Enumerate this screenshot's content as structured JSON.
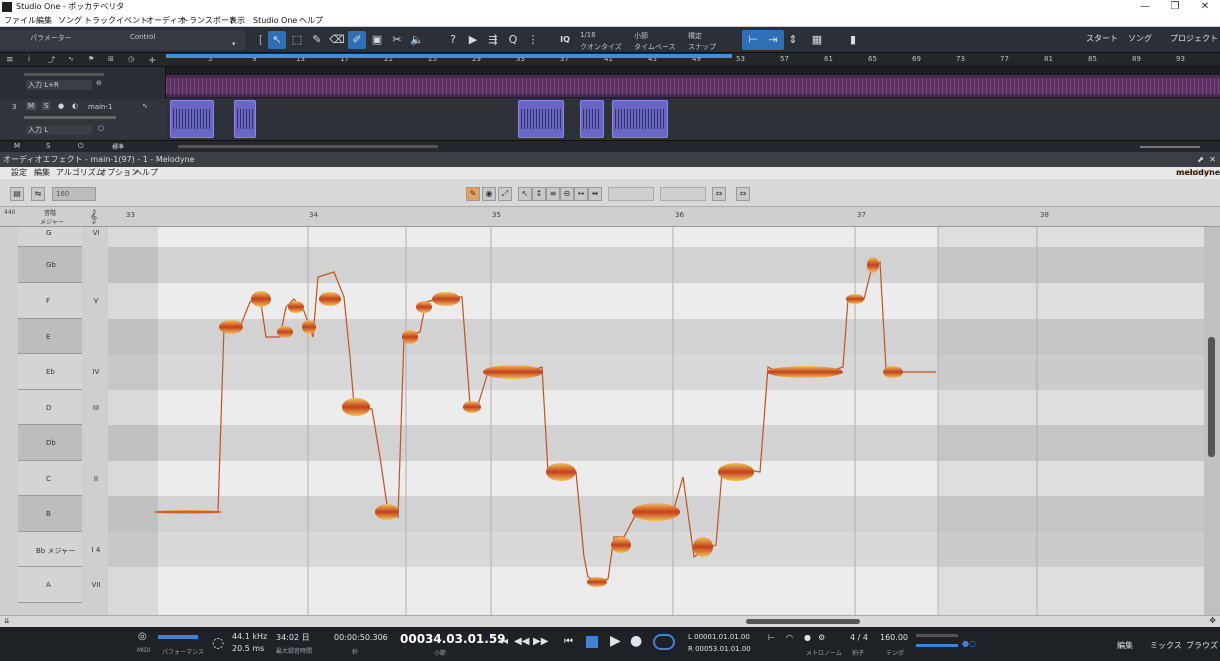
{
  "window": {
    "title": "Studio One - ポッカテベリタ",
    "controls": [
      "—",
      "❐",
      "✕"
    ]
  },
  "menu": [
    "ファイル",
    "編集",
    "ソング",
    "トラック",
    "イベント",
    "オーディオ",
    "トランスポート",
    "表示",
    "Studio One",
    "ヘルプ"
  ],
  "toolbar": {
    "param_label": "パラメーター",
    "control_label": "Control",
    "quantize_value": "1/16",
    "quantize_label": "クオンタイズ",
    "timebase_value": "小節",
    "timebase_label": "タイムベース",
    "snap_value": "構定",
    "snap_label": "スナップ",
    "right_buttons": [
      "スタート",
      "ソング",
      "プロジェクト"
    ]
  },
  "arrange": {
    "ruler_ticks": [
      "5",
      "9",
      "13",
      "17",
      "21",
      "25",
      "29",
      "33",
      "37",
      "41",
      "45",
      "49",
      "53",
      "57",
      "61",
      "65",
      "69",
      "73",
      "77",
      "81",
      "85",
      "89",
      "93"
    ],
    "track1": {
      "input": "入力 L+R"
    },
    "track2": {
      "number": "3",
      "m": "M",
      "s": "S",
      "name": "main-1",
      "input": "入力 L"
    },
    "bottom_m": "M",
    "bottom_s": "S",
    "bottom_std": "標準"
  },
  "fx": {
    "title": "オーディオエフェクト - main-1(97) - 1 - Melodyne",
    "menu": [
      "設定",
      "編集",
      "アルゴリズム",
      "オプション",
      "ヘルプ"
    ],
    "logo_main": "melodyne",
    "logo_sub": "assistant",
    "zoom_value": "160",
    "ruler_ticks": [
      "33",
      "34",
      "35",
      "36",
      "37",
      "38"
    ],
    "key_header": "音階",
    "key_header_sub": "メジャー",
    "pitch_ref": "440",
    "notes": [
      {
        "name": "G",
        "scale": "VI"
      },
      {
        "name": "Gb",
        "scale": ""
      },
      {
        "name": "F",
        "scale": "V"
      },
      {
        "name": "E",
        "scale": ""
      },
      {
        "name": "Eb",
        "scale": "IV"
      },
      {
        "name": "D",
        "scale": "III"
      },
      {
        "name": "Db",
        "scale": ""
      },
      {
        "name": "C",
        "scale": "II"
      },
      {
        "name": "B",
        "scale": ""
      },
      {
        "name": "Bb メジャー",
        "scale": "I 4"
      },
      {
        "name": "A",
        "scale": "VII"
      }
    ]
  },
  "transport": {
    "midi": "MIDI",
    "perf": "パフォーマンス",
    "rate": "44.1 kHz",
    "latency": "20.5 ms",
    "record_time": "34:02 日",
    "record_label": "最大録音時間",
    "seconds": "00:00:50.306",
    "seconds_label": "秒",
    "position": "00034.03.01.59",
    "position_label": "小節",
    "loop_l": "L  00001.01.01.00",
    "loop_r": "R  00053.01.01.00",
    "metronome_label": "メトロノーム",
    "signature": "4 / 4",
    "signature_label": "拍子",
    "tempo": "160.00",
    "tempo_label": "テンポ",
    "right_buttons": [
      "編集",
      "ミックス",
      "ブラウズ"
    ]
  }
}
